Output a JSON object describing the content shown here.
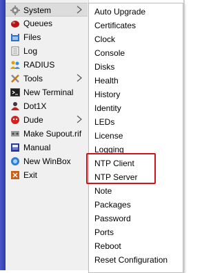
{
  "side_menu": {
    "items": [
      {
        "label": "System",
        "icon": "gear-icon",
        "has_submenu": true,
        "selected": true
      },
      {
        "label": "Queues",
        "icon": "queues-icon",
        "has_submenu": false
      },
      {
        "label": "Files",
        "icon": "files-icon",
        "has_submenu": false
      },
      {
        "label": "Log",
        "icon": "log-icon",
        "has_submenu": false
      },
      {
        "label": "RADIUS",
        "icon": "radius-icon",
        "has_submenu": false
      },
      {
        "label": "Tools",
        "icon": "tools-icon",
        "has_submenu": true
      },
      {
        "label": "New Terminal",
        "icon": "terminal-icon",
        "has_submenu": false
      },
      {
        "label": "Dot1X",
        "icon": "dot1x-icon",
        "has_submenu": false
      },
      {
        "label": "Dude",
        "icon": "dude-icon",
        "has_submenu": true
      },
      {
        "label": "Make Supout.rif",
        "icon": "supout-icon",
        "has_submenu": false
      },
      {
        "label": "Manual",
        "icon": "manual-icon",
        "has_submenu": false
      },
      {
        "label": "New WinBox",
        "icon": "winbox-icon",
        "has_submenu": false
      },
      {
        "label": "Exit",
        "icon": "exit-icon",
        "has_submenu": false
      }
    ]
  },
  "system_submenu": {
    "items": [
      "Auto Upgrade",
      "Certificates",
      "Clock",
      "Console",
      "Disks",
      "Health",
      "History",
      "Identity",
      "LEDs",
      "License",
      "Logging",
      "NTP Client",
      "NTP Server",
      "Note",
      "Packages",
      "Password",
      "Ports",
      "Reboot",
      "Reset Configuration"
    ],
    "highlighted": [
      "NTP Client",
      "NTP Server"
    ]
  },
  "colors": {
    "highlight_border": "#d0101a",
    "sidebar_bg": "#f0f0f0",
    "selected_bg": "#dcdcdc",
    "left_strip": "#3a48b8"
  }
}
